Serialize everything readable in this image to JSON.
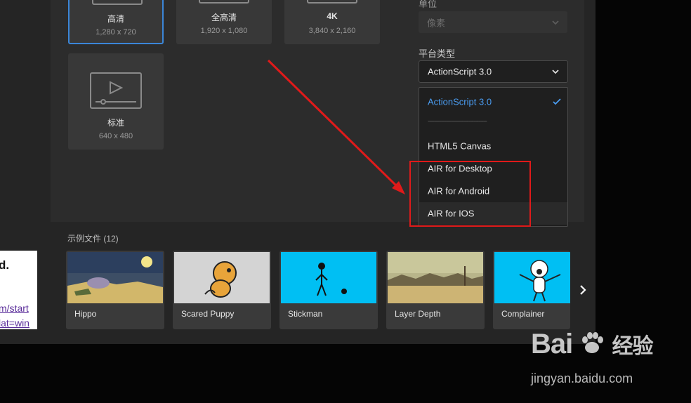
{
  "presets": [
    {
      "name": "高清",
      "size": "1,280 x 720"
    },
    {
      "name": "全高清",
      "size": "1,920 x 1,080"
    },
    {
      "name": "4K",
      "size": "3,840 x 2,160"
    },
    {
      "name": "标准",
      "size": "640 x 480"
    }
  ],
  "settings": {
    "unit_label": "单位",
    "unit_value": "像素",
    "platform_label": "平台类型",
    "platform_value": "ActionScript 3.0"
  },
  "dropdown": {
    "selected": "ActionScript 3.0",
    "separator": "------------------------------------",
    "options": [
      "HTML5 Canvas",
      "AIR for Desktop",
      "AIR for Android",
      "AIR for IOS"
    ]
  },
  "samples": {
    "title": "示例文件 (12)",
    "items": [
      "Hippo",
      "Scared Puppy",
      "Stickman",
      "Layer Depth",
      "Complainer"
    ]
  },
  "background_page": {
    "text": "d.",
    "link1": "m/start",
    "link2": "lat=win"
  },
  "watermark": {
    "brand": "Bai",
    "brand2": "经验",
    "url": "jingyan.baidu.com"
  },
  "colors": {
    "accent": "#3b86d8",
    "annotation": "#e01a1a",
    "sky": "#00bff3"
  }
}
